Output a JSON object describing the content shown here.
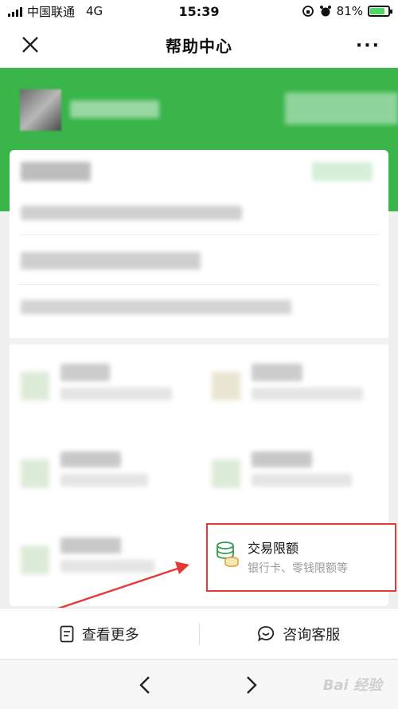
{
  "status_bar": {
    "carrier": "中国联通",
    "network": "4G",
    "time": "15:39",
    "battery": "81%",
    "battery_level": 0.81
  },
  "nav": {
    "title": "帮助中心",
    "more": "···"
  },
  "feature": {
    "title": "交易限额",
    "subtitle": "银行卡、零钱限额等"
  },
  "actions": {
    "view_more": "查看更多",
    "customer_service": "咨询客服"
  },
  "browser": {
    "watermark": "Bai 经验"
  },
  "colors": {
    "header_green": "#39b54a",
    "highlight_red": "#e53935",
    "arrow_red": "#e53935"
  }
}
